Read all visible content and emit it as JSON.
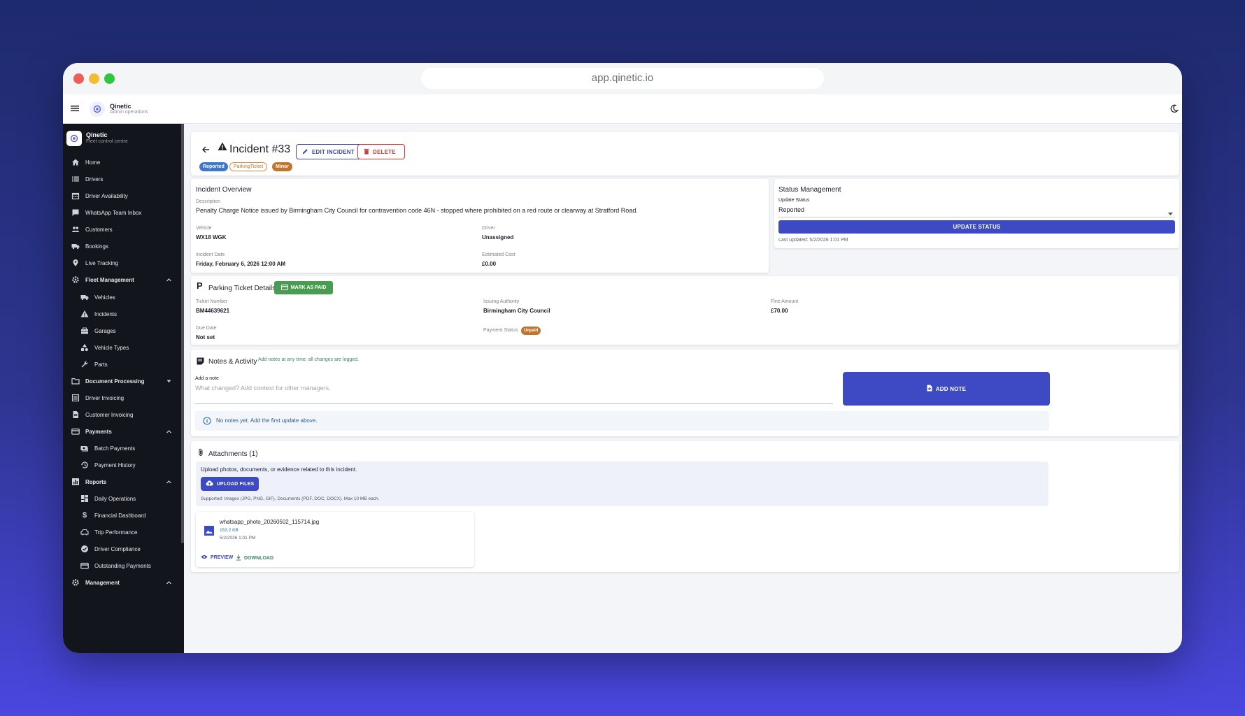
{
  "browser": {
    "url": "app.qinetic.io"
  },
  "appbar": {
    "title": "Qinetic",
    "subtitle": "Admin operations"
  },
  "sidebar": {
    "brand_title": "Qinetic",
    "brand_subtitle": "Fleet control centre",
    "items": [
      {
        "label": "Home",
        "icon": "home-icon"
      },
      {
        "label": "Drivers",
        "icon": "list-icon"
      },
      {
        "label": "Driver Availability",
        "icon": "calendar-icon"
      },
      {
        "label": "WhatsApp Team Inbox",
        "icon": "chat-icon"
      },
      {
        "label": "Customers",
        "icon": "people-icon"
      },
      {
        "label": "Bookings",
        "icon": "truck-icon"
      },
      {
        "label": "Live Tracking",
        "icon": "location-pin-icon"
      },
      {
        "label": "Fleet Management",
        "icon": "gear-icon"
      },
      {
        "label": "Vehicles",
        "icon": "truck-icon"
      },
      {
        "label": "Incidents",
        "icon": "warning-icon"
      },
      {
        "label": "Garages",
        "icon": "garage-icon"
      },
      {
        "label": "Vehicle Types",
        "icon": "shapes-icon"
      },
      {
        "label": "Parts",
        "icon": "wrench-icon"
      },
      {
        "label": "Document Processing",
        "icon": "folder-icon"
      },
      {
        "label": "Driver Invoicing",
        "icon": "list-icon"
      },
      {
        "label": "Customer Invoicing",
        "icon": "document-icon"
      },
      {
        "label": "Payments",
        "icon": "card-icon"
      },
      {
        "label": "Batch Payments",
        "icon": "cash-icon"
      },
      {
        "label": "Payment History",
        "icon": "history-icon"
      },
      {
        "label": "Reports",
        "icon": "chart-icon"
      },
      {
        "label": "Daily Operations",
        "icon": "dashboard-icon"
      },
      {
        "label": "Financial Dashboard",
        "icon": "dollar-icon"
      },
      {
        "label": "Trip Performance",
        "icon": "car-icon"
      },
      {
        "label": "Driver Compliance",
        "icon": "verified-icon"
      },
      {
        "label": "Outstanding Payments",
        "icon": "card-icon"
      },
      {
        "label": "Management",
        "icon": "gear-icon"
      }
    ]
  },
  "incident": {
    "title": "Incident #33",
    "edit_label": "EDIT INCIDENT",
    "delete_label": "DELETE",
    "chips": {
      "status": "Reported",
      "type": "ParkingTicket",
      "severity": "Minor"
    }
  },
  "overview": {
    "title": "Incident Overview",
    "description_label": "Description",
    "description": "Penalty Charge Notice issued by Birmingham City Council for contravention code 46N - stopped where prohibited on a red route or clearway at Stratford Road.",
    "vehicle_label": "Vehicle",
    "vehicle": "WX18 WGK",
    "driver_label": "Driver",
    "driver": "Unassigned",
    "date_label": "Incident Date",
    "date": "Friday, February 6, 2026 12:00 AM",
    "cost_label": "Estimated Cost",
    "cost": "£0.00"
  },
  "status": {
    "title": "Status Management",
    "select_label": "Update Status",
    "selected": "Reported",
    "button_label": "UPDATE STATUS",
    "last_updated": "Last updated: 5/2/2026 1:01 PM"
  },
  "parking": {
    "title": "Parking Ticket Details",
    "mark_paid_label": "MARK AS PAID",
    "ticket_label": "Ticket Number",
    "ticket": "BM44639621",
    "authority_label": "Issuing Authority",
    "authority": "Birmingham City Council",
    "fine_label": "Fine Amount",
    "fine": "£70.00",
    "due_label": "Due Date",
    "due": "Not set",
    "payment_label": "Payment Status",
    "payment": "Unpaid"
  },
  "notes": {
    "title": "Notes & Activity",
    "hint": "Add notes at any time; all changes are logged.",
    "input_label": "Add a note",
    "placeholder": "What changed? Add context for other managers.",
    "add_label": "ADD NOTE",
    "empty": "No notes yet. Add the first update above."
  },
  "attachments": {
    "title": "Attachments (1)",
    "intro": "Upload photos, documents, or evidence related to this incident.",
    "upload_label": "UPLOAD FILES",
    "supported": "Supported: Images (JPG, PNG, GIF), Documents (PDF, DOC, DOCX). Max 10 MB each.",
    "files": [
      {
        "name": "whatsapp_photo_20260502_115714.jpg",
        "size": "153.2 KB",
        "date": "5/2/2026 1:01 PM",
        "preview": "PREVIEW",
        "download": "DOWNLOAD"
      }
    ]
  },
  "colors": {
    "primary": "#3d4ac3",
    "success": "#4a9c52",
    "danger": "#d43b36",
    "warning": "#c0742c",
    "sidebar": "#13151c"
  }
}
